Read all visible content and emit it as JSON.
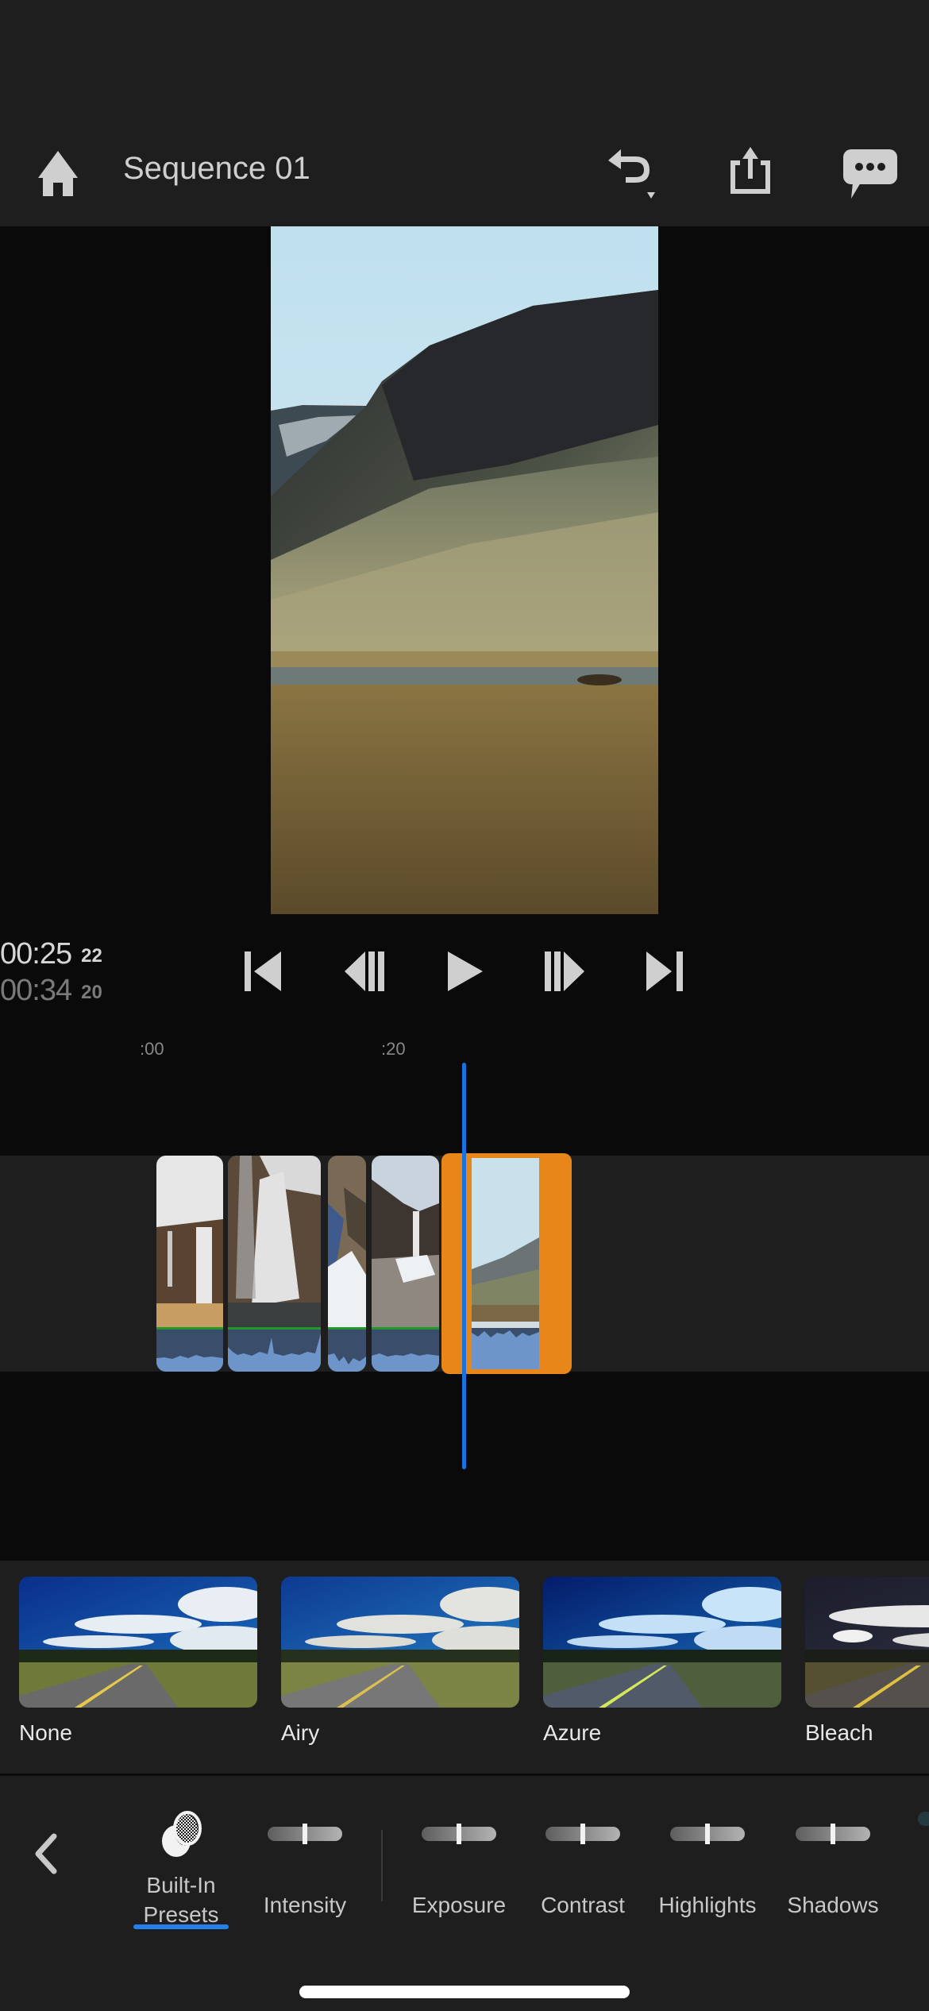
{
  "app": {
    "sequence_title": "Sequence 01"
  },
  "header": {
    "icons": [
      "home-icon",
      "undo-icon",
      "share-icon",
      "chat-icon"
    ]
  },
  "playback": {
    "current_time": "00:25",
    "current_frames": "22",
    "total_time": "00:34",
    "total_frames": "20",
    "controls": [
      "skip-to-start",
      "step-back",
      "play",
      "step-forward",
      "skip-to-end"
    ]
  },
  "timeline": {
    "ruler_labels": [
      ":00",
      ":20"
    ],
    "clips": [
      {
        "name": "waterfall-clip-1",
        "selected": false
      },
      {
        "name": "waterfall-clip-2",
        "selected": false
      },
      {
        "name": "snow-rock-clip",
        "selected": false
      },
      {
        "name": "waterfall-clip-3",
        "selected": false
      },
      {
        "name": "mountain-clip",
        "selected": true
      }
    ],
    "colors": {
      "playhead": "#1a72e0",
      "selection": "#e8861a",
      "audio": "#6e95c9"
    }
  },
  "presets": {
    "items": [
      {
        "label": "None"
      },
      {
        "label": "Airy"
      },
      {
        "label": "Azure"
      },
      {
        "label": "Bleach"
      }
    ]
  },
  "toolbar": {
    "back_icon": "chevron-left-icon",
    "tools": [
      {
        "label_line1": "Built-In",
        "label_line2": "Presets",
        "active": true
      },
      {
        "label": "Intensity",
        "value": 0.5
      },
      {
        "label": "Exposure",
        "value": 0.5
      },
      {
        "label": "Contrast",
        "value": 0.5
      },
      {
        "label": "Highlights",
        "value": 0.5
      },
      {
        "label": "Shadows",
        "value": 0.5
      }
    ],
    "accent": "#2680eb"
  }
}
